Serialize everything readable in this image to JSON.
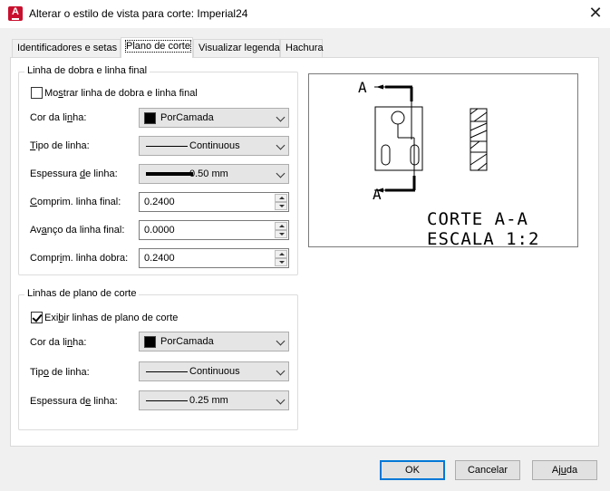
{
  "window": {
    "title": "Alterar o estilo de vista para corte: Imperial24",
    "close_glyph": "✕",
    "app_icon": "autocad-a-icon"
  },
  "tabs": [
    {
      "label": "Identificadores e setas",
      "active": false
    },
    {
      "label": "Plano de corte",
      "active": true
    },
    {
      "label": "Visualizar legenda",
      "active": false
    },
    {
      "label": "Hachura",
      "active": false
    }
  ],
  "fold_group": {
    "title": "Linha de dobra e linha final",
    "show_checkbox": {
      "label_pre": "Mo",
      "label_key": "s",
      "label_post": "trar linha de dobra e linha final",
      "checked": false
    },
    "line_color": {
      "label_pre": "Cor da li",
      "label_key": "n",
      "label_post": "ha:",
      "value": "PorCamada"
    },
    "line_type": {
      "label_pre": "",
      "label_key": "T",
      "label_post": "ipo de linha:",
      "value": "Continuous"
    },
    "line_weight": {
      "label_pre": "Espessura ",
      "label_key": "d",
      "label_post": "e linha:",
      "value": "0.50 mm"
    },
    "end_length": {
      "label_pre": "",
      "label_key": "C",
      "label_post": "omprim. linha final:",
      "value": "0.2400"
    },
    "end_overshoot": {
      "label_pre": "Av",
      "label_key": "a",
      "label_post": "nço da linha final:",
      "value": "0.0000"
    },
    "fold_length": {
      "label_pre": "Compr",
      "label_key": "i",
      "label_post": "m. linha dobra:",
      "value": "0.2400"
    }
  },
  "plane_group": {
    "title": "Linhas de plano de corte",
    "show_checkbox": {
      "label_pre": "Exi",
      "label_key": "b",
      "label_post": "ir linhas de plano de corte",
      "checked": true
    },
    "line_color": {
      "label_pre": "Cor da li",
      "label_key": "n",
      "label_post": "ha:",
      "value": "PorCamada"
    },
    "line_type": {
      "label_pre": "Tip",
      "label_key": "o",
      "label_post": " de linha:",
      "value": "Continuous"
    },
    "line_weight": {
      "label_pre": "Espessura d",
      "label_key": "e",
      "label_post": " linha:",
      "value": "0.25 mm"
    }
  },
  "preview": {
    "label_top": "A",
    "label_bottom": "A",
    "caption_line1": "CORTE A-A",
    "caption_line2": "ESCALA 1:2"
  },
  "buttons": {
    "ok": "OK",
    "cancel": "Cancelar",
    "help_pre": "Aj",
    "help_key": "u",
    "help_post": "da"
  }
}
